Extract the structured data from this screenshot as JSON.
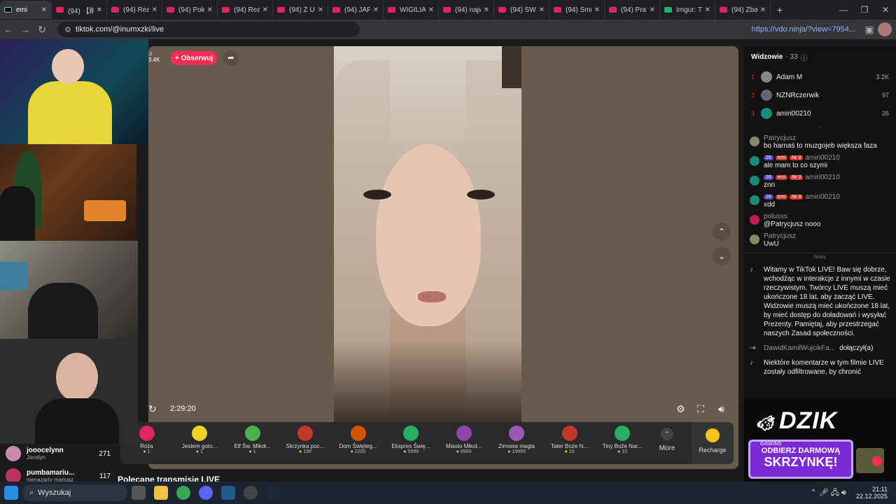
{
  "tabs": [
    {
      "title": "emi",
      "icon": "tiktok-icon",
      "active": true
    },
    {
      "title": "(94) 【刷",
      "icon": "youtube-icon"
    },
    {
      "title": "(94) Real",
      "icon": "youtube-icon"
    },
    {
      "title": "(94) Poke",
      "icon": "youtube-icon"
    },
    {
      "title": "(94) Real",
      "icon": "youtube-icon"
    },
    {
      "title": "(94) Z Ur",
      "icon": "youtube-icon"
    },
    {
      "title": "(94) JAPO",
      "icon": "youtube-icon"
    },
    {
      "title": "WIGILIA",
      "icon": "youtube-icon"
    },
    {
      "title": "(94) najw",
      "icon": "youtube-icon"
    },
    {
      "title": "(94) ŚWI",
      "icon": "youtube-icon"
    },
    {
      "title": "(94) Smu",
      "icon": "youtube-icon"
    },
    {
      "title": "(94) Pra",
      "icon": "youtube-icon"
    },
    {
      "title": "Imgur: T",
      "icon": "imgur-icon"
    },
    {
      "title": "(94) Zba",
      "icon": "youtube-icon"
    }
  ],
  "url": "tiktok.com/@inumxzki/live",
  "vdo_link": "https://vdo.ninja/?view=7954...",
  "stream": {
    "followers": "3.4K",
    "follow_label": "+ Obserwuj",
    "timer": "2:29:20"
  },
  "viewers": {
    "title": "Widzowie",
    "count": "· 33",
    "list": [
      {
        "rank": "1",
        "name": "Adam M",
        "count": "3.2K"
      },
      {
        "rank": "2",
        "name": "NZNRczerwik",
        "count": "97"
      },
      {
        "rank": "3",
        "name": "amiri00210",
        "count": "26"
      }
    ]
  },
  "chat": [
    {
      "user": "Patrycjusz",
      "text": "bo harnaś to muzgojeb większa faza",
      "badges": []
    },
    {
      "user": "amiri00210",
      "text": "ale mam to co szymi",
      "badges": [
        "26",
        "emi",
        "Nr 3"
      ]
    },
    {
      "user": "amiri00210",
      "text": "znn",
      "badges": [
        "26",
        "emi",
        "Nr 3"
      ]
    },
    {
      "user": "amiri00210",
      "text": "xdd",
      "badges": [
        "26",
        "emi",
        "Nr 3"
      ]
    },
    {
      "user": "polusss",
      "text": "@Patrycjusz nooo",
      "badges": []
    },
    {
      "user": "Patrycjusz",
      "text": "UwU",
      "badges": []
    }
  ],
  "new_label": "Nowy",
  "system_msg": "Witamy w TikTok LIVE! Baw się dobrze, wchodźąc w interakcje z innymi w czasie rzeczywistym. Twórcy LIVE muszą mieć ukończone 18 lat, aby zacząć LIVE. Widzowie muszą mieć ukończone 18 lat, by mieć dostęp do doładowań i wysyłać Prezenty. Pamiętaj, aby przestrzegać naszych Zasad społeczności.",
  "join": {
    "user": "DawidKamilWujcikFa...",
    "action": "dołączył(a)"
  },
  "filter_msg": "Niektóre komentarze w tym filmie LIVE zostały odfiltrowane, by chronić",
  "gifts": [
    {
      "name": "Róża",
      "price": "1",
      "color": "#e0245e"
    },
    {
      "name": "Jestem goto...",
      "price": "1",
      "color": "#f2d024"
    },
    {
      "name": "Elf Św. Mikoł...",
      "price": "1",
      "color": "#4caf50"
    },
    {
      "name": "Skrzynka poc...",
      "price": "199",
      "color": "#c0392b"
    },
    {
      "name": "Dom Święteg...",
      "price": "2200",
      "color": "#d35400"
    },
    {
      "name": "Ekspres Świę...",
      "price": "5999",
      "color": "#27ae60"
    },
    {
      "name": "Miasto Mikoł...",
      "price": "9999",
      "color": "#8e44ad"
    },
    {
      "name": "Zimowa magia",
      "price": "19999",
      "color": "#9b59b6"
    },
    {
      "name": "Tater Boże N...",
      "price": "10",
      "color": "#c0392b"
    },
    {
      "name": "Tiny Boże Nar...",
      "price": "10",
      "color": "#27ae60"
    }
  ],
  "more_label": "More",
  "recharge_label": "Recharge",
  "left_list": [
    {
      "name": "jooocelynn",
      "sub": "Jocelyn",
      "count": "271"
    },
    {
      "name": "pumbamariu...",
      "sub": "nienazarty mariusz",
      "count": "117"
    }
  ],
  "recommended": "Polecane transmisje LIVE",
  "ad": {
    "brand": "DZIK",
    "line1": "ODBIERZ DARMOWĄ",
    "line2": "SKRZYNKĘ!",
    "tag": "G4SKINS"
  },
  "taskbar": {
    "search": "Wyszukaj",
    "time": "21:11",
    "date": "22.12.2025"
  }
}
